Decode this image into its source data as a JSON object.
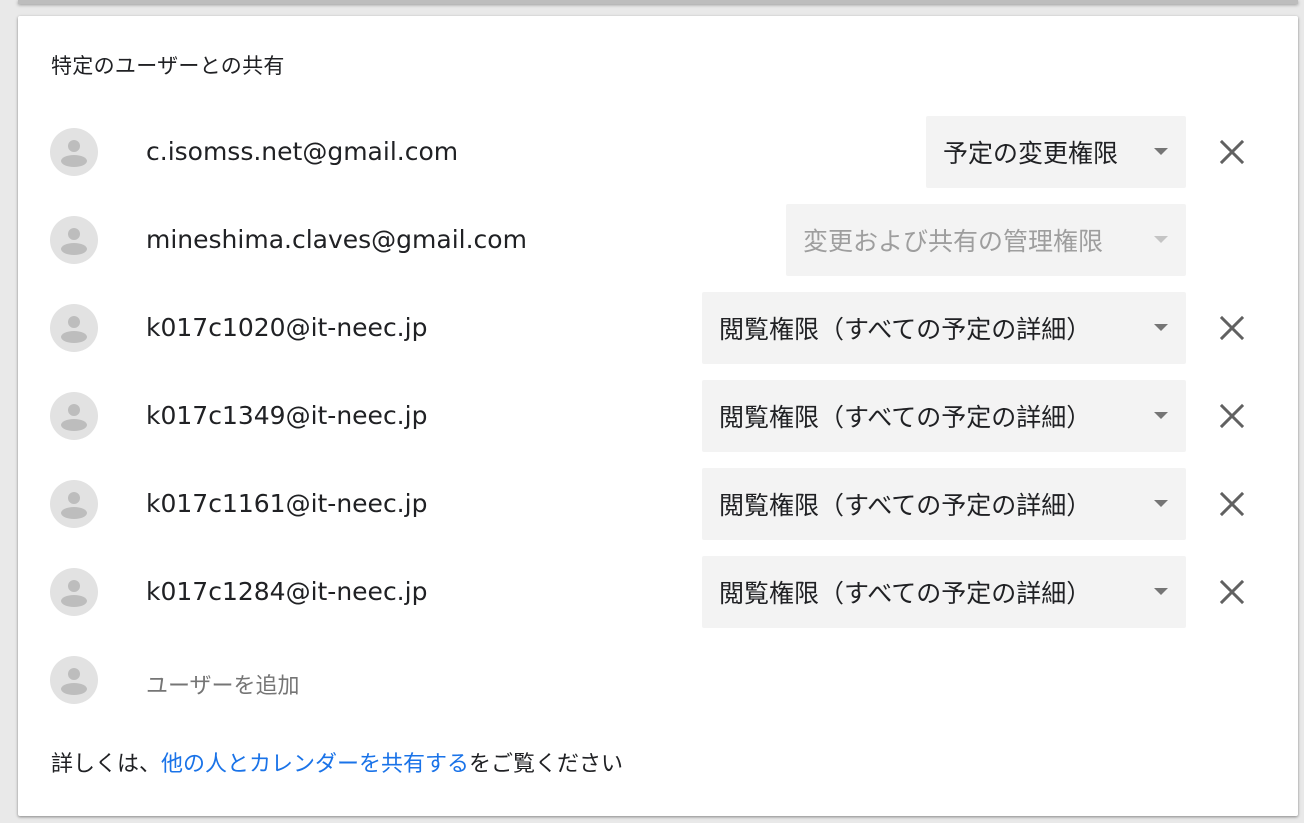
{
  "section": {
    "title": "特定のユーザーとの共有"
  },
  "users": [
    {
      "email": "c.isomss.net@gmail.com",
      "permission": "予定の変更権限",
      "removable": true,
      "disabled": false
    },
    {
      "email": "mineshima.claves@gmail.com",
      "permission": "変更および共有の管理権限",
      "removable": false,
      "disabled": true
    },
    {
      "email": "k017c1020@it-neec.jp",
      "permission": "閲覧権限（すべての予定の詳細）",
      "removable": true,
      "disabled": false
    },
    {
      "email": "k017c1349@it-neec.jp",
      "permission": "閲覧権限（すべての予定の詳細）",
      "removable": true,
      "disabled": false
    },
    {
      "email": "k017c1161@it-neec.jp",
      "permission": "閲覧権限（すべての予定の詳細）",
      "removable": true,
      "disabled": false
    },
    {
      "email": "k017c1284@it-neec.jp",
      "permission": "閲覧権限（すべての予定の詳細）",
      "removable": true,
      "disabled": false
    }
  ],
  "add_user": {
    "label": "ユーザーを追加"
  },
  "footer": {
    "prefix": "詳しくは、",
    "link_text": "他の人とカレンダーを共有する",
    "suffix": "をご覧ください"
  },
  "icons": {
    "avatar": "person-avatar-icon",
    "remove": "close-icon",
    "dropdown": "arrow-drop-down-icon"
  },
  "colors": {
    "link": "#1a73e8",
    "dropdown_bg": "#f3f3f3",
    "avatar_bg": "#e2e2e2",
    "text_secondary": "#757575"
  }
}
